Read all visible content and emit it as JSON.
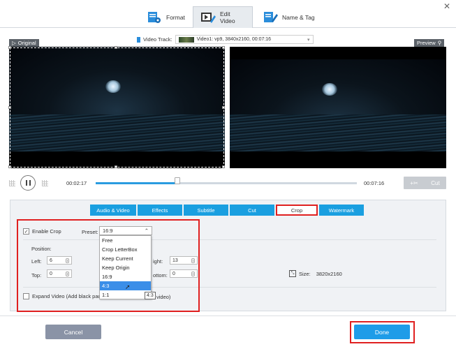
{
  "window": {
    "close_glyph": "✕"
  },
  "top_tabs": [
    {
      "label": "Format",
      "icon": "format-icon"
    },
    {
      "label": "Edit Video",
      "icon": "edit-video-icon"
    },
    {
      "label": "Name & Tag",
      "icon": "name-tag-icon"
    }
  ],
  "video_track": {
    "label": "Video Track:",
    "value": "Video1: vp9, 3840x2160, 00:07:16"
  },
  "panels": {
    "original_label": "Original",
    "preview_label": "Preview"
  },
  "player": {
    "current_time": "00:02:17",
    "total_time": "00:07:16",
    "progress": 0.31,
    "cut_label": "Cut"
  },
  "edit_tabs": [
    "Audio & Video",
    "Effects",
    "Subtitle",
    "Cut",
    "Crop",
    "Watermark"
  ],
  "crop": {
    "enable_label": "Enable Crop",
    "enable_checked": "✓",
    "preset_label": "Preset:",
    "preset_value": "16:9",
    "position_label": "Position:",
    "left_label": "Left:",
    "left_value": "6",
    "top_label": "Top:",
    "top_value": "0",
    "right_label": "ight:",
    "right_value": "13",
    "bottom_label": "ottom:",
    "bottom_value": "0",
    "size_label": "Size:",
    "size_value": "3820x2160",
    "expand_label": "Expand Video (Add black pad",
    "expand_suffix": "video)",
    "preset_options": [
      "Free",
      "Crop LetterBox",
      "Keep Current",
      "Keep Origin",
      "16:9",
      "4:3",
      "1:1"
    ],
    "highlighted_option": "4:3",
    "tooltip": "4:3"
  },
  "buttons": {
    "cancel": "Cancel",
    "done": "Done"
  },
  "colors": {
    "accent": "#1e9ce8",
    "highlight_red": "#e02020"
  }
}
